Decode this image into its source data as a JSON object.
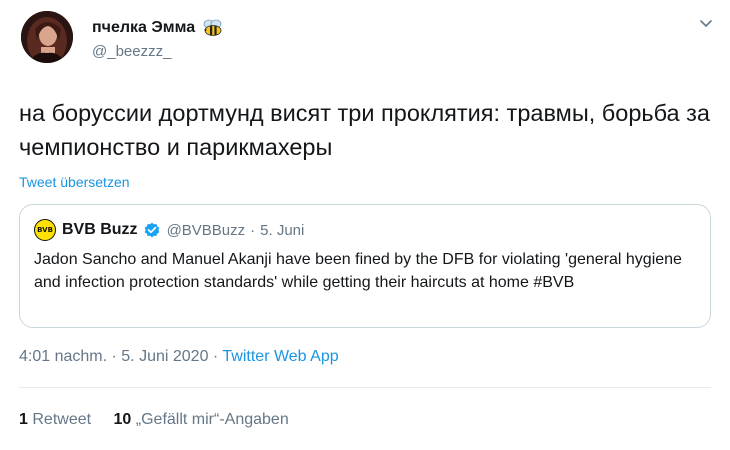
{
  "author": {
    "display_name": "пчелка Эмма",
    "handle": "@_beezzz_",
    "avatar_icon": "avatar-photo",
    "emoji_icon": "bee-icon"
  },
  "tweet": {
    "text": "на боруссии дортмунд висят три проклятия: травмы, борьба за чемпионство и парикмахеры",
    "translate_label": "Tweet übersetzen"
  },
  "quoted_tweet": {
    "name": "BVB Buzz",
    "handle": "@BVBBuzz",
    "separator": "·",
    "date": "5. Juni",
    "logo_icon": "bvb-logo-icon",
    "verified_icon": "verified-badge-icon",
    "text": "Jadon Sancho and Manuel Akanji have been fined by the DFB for violating 'general hygiene and infection protection standards' while getting their haircuts at home #BVB"
  },
  "meta": {
    "time": "4:01 nachm.",
    "separator": " · ",
    "date": "5. Juni 2020",
    "separator2": " · ",
    "source": "Twitter Web App"
  },
  "stats": {
    "retweets_count": "1",
    "retweets_label": "Retweet",
    "likes_count": "10",
    "likes_label": "„Gefällt mir“-Angaben"
  },
  "colors": {
    "link": "#1b95e0",
    "secondary_text": "#657786",
    "primary_text": "#14171a",
    "border": "#ccd6dd",
    "verified": "#1da1f2",
    "bvb_yellow": "#fde100"
  }
}
